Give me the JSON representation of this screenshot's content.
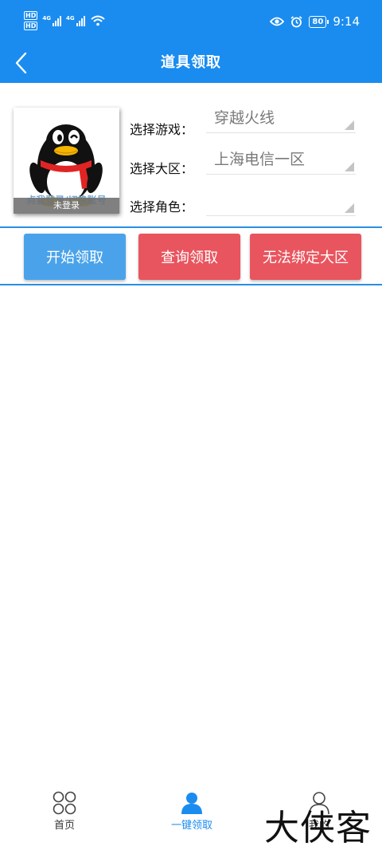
{
  "status_bar": {
    "hd_badges": [
      "HD",
      "HD"
    ],
    "network_labels": [
      "4G",
      "4G"
    ],
    "battery_level": "80",
    "time": "9:14"
  },
  "header": {
    "title": "道具领取",
    "back_icon": "chevron-left-icon"
  },
  "account": {
    "avatar_icon": "qq-penguin-icon",
    "login_link": "点我登录/切换账号",
    "login_status": "未登录"
  },
  "form": {
    "game_label": "选择游戏：",
    "game_value": "穿越火线",
    "area_label": "选择大区：",
    "area_value": "上海电信一区",
    "role_label": "选择角色：",
    "role_value": ""
  },
  "actions": {
    "start_label": "开始领取",
    "query_label": "查询领取",
    "unbind_label": "无法绑定大区"
  },
  "bottom_nav": {
    "items": [
      {
        "label": "首页",
        "icon": "grid-circles-icon",
        "active": false
      },
      {
        "label": "一键领取",
        "icon": "user-filled-icon",
        "active": true
      },
      {
        "label": "我的",
        "icon": "user-outline-icon",
        "active": false
      }
    ]
  },
  "watermark": "大侠客",
  "colors": {
    "primary": "#1a8cf0",
    "start_button": "#4aa3ea",
    "danger_button": "#e8555e",
    "divider": "#2a8ee4"
  }
}
